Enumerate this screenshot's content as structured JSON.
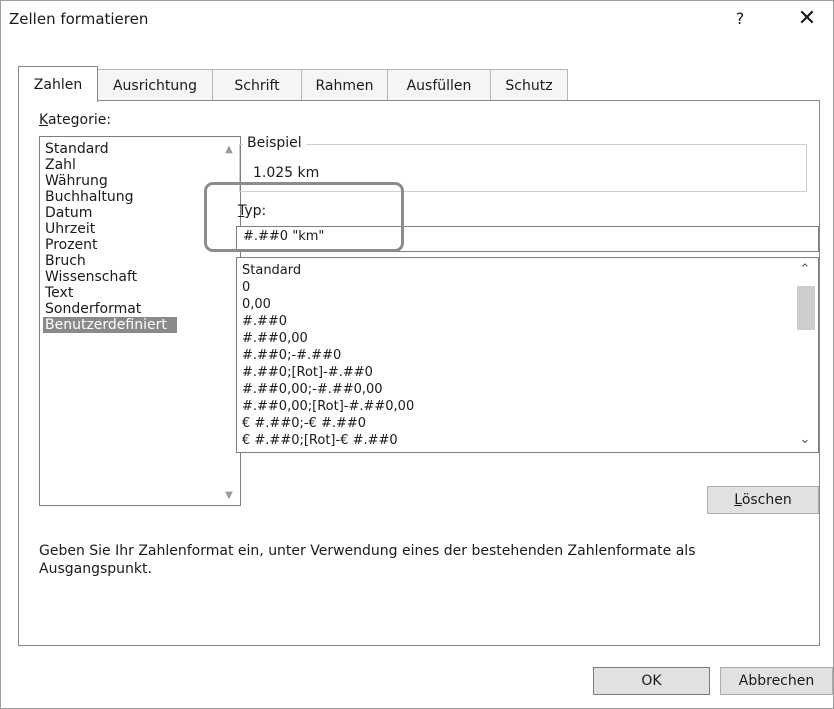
{
  "dialog": {
    "title": "Zellen formatieren",
    "help_label": "?",
    "close_label": "✕"
  },
  "tabs": [
    {
      "label": "Zahlen",
      "active": true
    },
    {
      "label": "Ausrichtung",
      "active": false
    },
    {
      "label": "Schrift",
      "active": false
    },
    {
      "label": "Rahmen",
      "active": false
    },
    {
      "label": "Ausfüllen",
      "active": false
    },
    {
      "label": "Schutz",
      "active": false
    }
  ],
  "category": {
    "label_prefix": "K",
    "label_rest": "ategorie:",
    "items": [
      "Standard",
      "Zahl",
      "Währung",
      "Buchhaltung",
      "Datum",
      "Uhrzeit",
      "Prozent",
      "Bruch",
      "Wissenschaft",
      "Text",
      "Sonderformat",
      "Benutzerdefiniert"
    ],
    "selected": "Benutzerdefiniert"
  },
  "sample": {
    "legend": "Beispiel",
    "value": "1.025 km"
  },
  "type": {
    "label_prefix": "T",
    "label_rest": "yp:",
    "value": "#.##0 \"km\""
  },
  "formats": [
    "Standard",
    "0",
    "0,00",
    "#.##0",
    "#.##0,00",
    "#.##0;-#.##0",
    "#.##0;[Rot]-#.##0",
    "#.##0,00;-#.##0,00",
    "#.##0,00;[Rot]-#.##0,00",
    "€ #.##0;-€ #.##0",
    "€ #.##0;[Rot]-€ #.##0"
  ],
  "delete_button": {
    "prefix": "L",
    "rest": "öschen"
  },
  "hint": "Geben Sie Ihr Zahlenformat ein, unter Verwendung eines der bestehenden Zahlenformate als Ausgangspunkt.",
  "footer": {
    "ok_label": "OK",
    "cancel_label": "Abbrechen"
  },
  "colors": {
    "selection": "#8a8a8a",
    "highlight_border": "#8c8c8c"
  }
}
